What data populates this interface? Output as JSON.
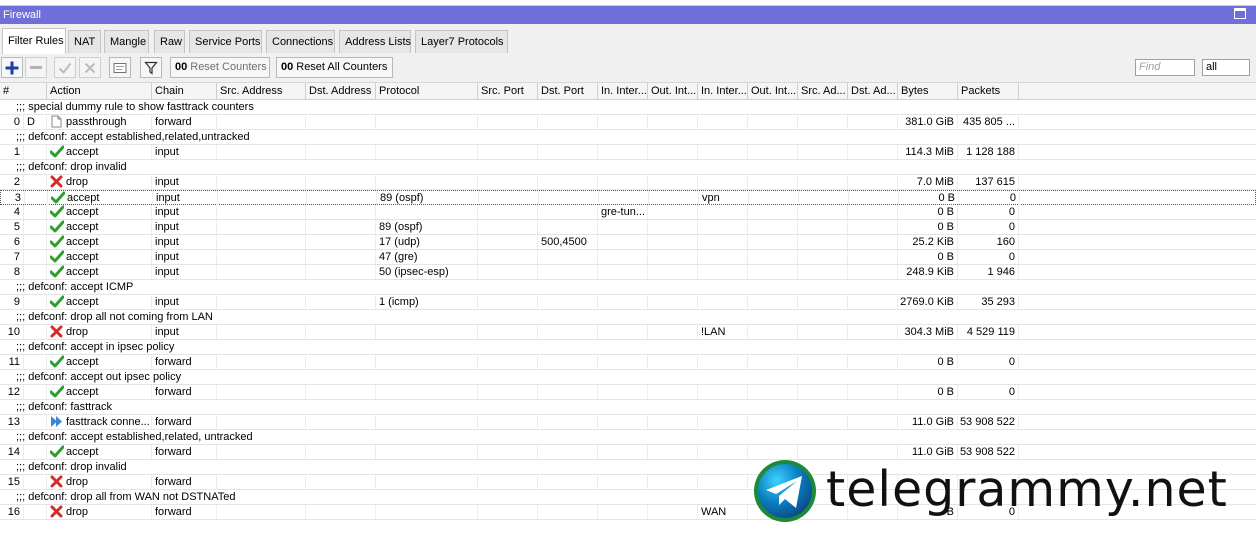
{
  "window": {
    "title": "Firewall"
  },
  "tabs": [
    "Filter Rules",
    "NAT",
    "Mangle",
    "Raw",
    "Service Ports",
    "Connections",
    "Address Lists",
    "Layer7 Protocols"
  ],
  "toolbar": {
    "counter_prefix": "00",
    "reset_counters": "Reset Counters",
    "reset_all_counters": "Reset All Counters",
    "find_placeholder": "Find",
    "filter_value": "all"
  },
  "columns": [
    "#",
    "Action",
    "Chain",
    "Src. Address",
    "Dst. Address",
    "Protocol",
    "Src. Port",
    "Dst. Port",
    "In. Inter...",
    "Out. Int...",
    "In. Inter...",
    "Out. Int...",
    "Src. Ad...",
    "Dst. Ad...",
    "Bytes",
    "Packets"
  ],
  "rows": [
    {
      "type": "comment",
      "text": ";;; special dummy rule to show fasttrack counters"
    },
    {
      "type": "rule",
      "idx": "0",
      "flag": "D",
      "icon": "passthrough-icon",
      "action": "passthrough",
      "chain": "forward",
      "protocol": "",
      "dst_port": "",
      "in_iface": "",
      "in_iface_list": "",
      "bytes": "381.0 GiB",
      "packets": "435 805 ..."
    },
    {
      "type": "comment",
      "text": ";;; defconf: accept established,related,untracked"
    },
    {
      "type": "rule",
      "idx": "1",
      "flag": "",
      "icon": "accept-icon",
      "action": "accept",
      "chain": "input",
      "protocol": "",
      "dst_port": "",
      "in_iface": "",
      "in_iface_list": "",
      "bytes": "114.3 MiB",
      "packets": "1 128 188"
    },
    {
      "type": "comment",
      "text": ";;; defconf: drop invalid"
    },
    {
      "type": "rule",
      "idx": "2",
      "flag": "",
      "icon": "drop-icon",
      "action": "drop",
      "chain": "input",
      "protocol": "",
      "dst_port": "",
      "in_iface": "",
      "in_iface_list": "",
      "bytes": "7.0 MiB",
      "packets": "137 615"
    },
    {
      "type": "rule",
      "idx": "3",
      "flag": "",
      "icon": "accept-icon",
      "action": "accept",
      "chain": "input",
      "protocol": "89 (ospf)",
      "dst_port": "",
      "in_iface": "",
      "in_iface_list": "vpn",
      "bytes": "0 B",
      "packets": "0",
      "selected": true
    },
    {
      "type": "rule",
      "idx": "4",
      "flag": "",
      "icon": "accept-icon",
      "action": "accept",
      "chain": "input",
      "protocol": "",
      "dst_port": "",
      "in_iface": "gre-tun...",
      "in_iface_list": "",
      "bytes": "0 B",
      "packets": "0"
    },
    {
      "type": "rule",
      "idx": "5",
      "flag": "",
      "icon": "accept-icon",
      "action": "accept",
      "chain": "input",
      "protocol": "89 (ospf)",
      "dst_port": "",
      "in_iface": "",
      "in_iface_list": "",
      "bytes": "0 B",
      "packets": "0"
    },
    {
      "type": "rule",
      "idx": "6",
      "flag": "",
      "icon": "accept-icon",
      "action": "accept",
      "chain": "input",
      "protocol": "17 (udp)",
      "dst_port": "500,4500",
      "in_iface": "",
      "in_iface_list": "",
      "bytes": "25.2 KiB",
      "packets": "160"
    },
    {
      "type": "rule",
      "idx": "7",
      "flag": "",
      "icon": "accept-icon",
      "action": "accept",
      "chain": "input",
      "protocol": "47 (gre)",
      "dst_port": "",
      "in_iface": "",
      "in_iface_list": "",
      "bytes": "0 B",
      "packets": "0"
    },
    {
      "type": "rule",
      "idx": "8",
      "flag": "",
      "icon": "accept-icon",
      "action": "accept",
      "chain": "input",
      "protocol": "50 (ipsec-esp)",
      "dst_port": "",
      "in_iface": "",
      "in_iface_list": "",
      "bytes": "248.9 KiB",
      "packets": "1 946"
    },
    {
      "type": "comment",
      "text": ";;; defconf: accept ICMP"
    },
    {
      "type": "rule",
      "idx": "9",
      "flag": "",
      "icon": "accept-icon",
      "action": "accept",
      "chain": "input",
      "protocol": "1 (icmp)",
      "dst_port": "",
      "in_iface": "",
      "in_iface_list": "",
      "bytes": "2769.0 KiB",
      "packets": "35 293"
    },
    {
      "type": "comment",
      "text": ";;; defconf: drop all not coming from LAN"
    },
    {
      "type": "rule",
      "idx": "10",
      "flag": "",
      "icon": "drop-icon",
      "action": "drop",
      "chain": "input",
      "protocol": "",
      "dst_port": "",
      "in_iface": "",
      "in_iface_list": "!LAN",
      "bytes": "304.3 MiB",
      "packets": "4 529 119"
    },
    {
      "type": "comment",
      "text": ";;; defconf: accept in ipsec policy"
    },
    {
      "type": "rule",
      "idx": "11",
      "flag": "",
      "icon": "accept-icon",
      "action": "accept",
      "chain": "forward",
      "protocol": "",
      "dst_port": "",
      "in_iface": "",
      "in_iface_list": "",
      "bytes": "0 B",
      "packets": "0"
    },
    {
      "type": "comment",
      "text": ";;; defconf: accept out ipsec policy"
    },
    {
      "type": "rule",
      "idx": "12",
      "flag": "",
      "icon": "accept-icon",
      "action": "accept",
      "chain": "forward",
      "protocol": "",
      "dst_port": "",
      "in_iface": "",
      "in_iface_list": "",
      "bytes": "0 B",
      "packets": "0"
    },
    {
      "type": "comment",
      "text": ";;; defconf: fasttrack"
    },
    {
      "type": "rule",
      "idx": "13",
      "flag": "",
      "icon": "fasttrack-icon",
      "action": "fasttrack conne...",
      "chain": "forward",
      "protocol": "",
      "dst_port": "",
      "in_iface": "",
      "in_iface_list": "",
      "bytes": "11.0 GiB",
      "packets": "53 908 522"
    },
    {
      "type": "comment",
      "text": ";;; defconf: accept established,related, untracked"
    },
    {
      "type": "rule",
      "idx": "14",
      "flag": "",
      "icon": "accept-icon",
      "action": "accept",
      "chain": "forward",
      "protocol": "",
      "dst_port": "",
      "in_iface": "",
      "in_iface_list": "",
      "bytes": "11.0 GiB",
      "packets": "53 908 522"
    },
    {
      "type": "comment",
      "text": ";;; defconf: drop invalid"
    },
    {
      "type": "rule",
      "idx": "15",
      "flag": "",
      "icon": "drop-icon",
      "action": "drop",
      "chain": "forward",
      "protocol": "",
      "dst_port": "",
      "in_iface": "",
      "in_iface_list": "",
      "bytes": "",
      "packets": ""
    },
    {
      "type": "comment",
      "text": ";;; defconf:  drop all from WAN not DSTNATed"
    },
    {
      "type": "rule",
      "idx": "16",
      "flag": "",
      "icon": "drop-icon",
      "action": "drop",
      "chain": "forward",
      "protocol": "",
      "dst_port": "",
      "in_iface": "",
      "in_iface_list": "WAN",
      "bytes": "B",
      "packets": "0"
    }
  ],
  "watermark": {
    "text": "telegrammy.net",
    "icon": "telegram-logo-icon"
  },
  "colors": {
    "titlebar": "#6f6fd9",
    "accept": "#2e9e2e",
    "drop": "#d42b2b",
    "add": "#1a3fa8",
    "fasttrack": "#3a86d9"
  }
}
